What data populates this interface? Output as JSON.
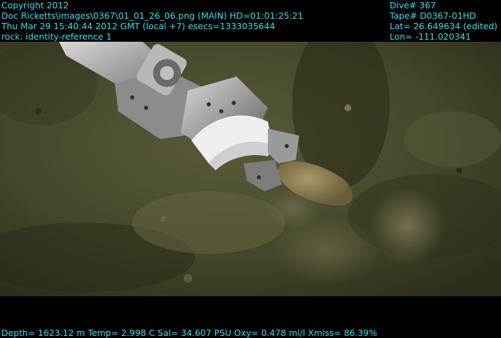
{
  "header_left": {
    "line1": "Copyright 2012",
    "line2": "Doc Ricketts\\images\\0367\\01_01_26_06.png (MAIN)  HD=01:01:25:21",
    "line3": "Thu Mar 29 15:40:44 2012 GMT (local +7)  esecs=1333035644",
    "line4": "rock: identity-reference 1"
  },
  "header_right": {
    "line1": "Dive# 367",
    "line2": "Tape# D0367-01HD",
    "line3": "Lat= 26.649634 (edited)",
    "line4": "Lon= -111.020341"
  },
  "footer": {
    "telemetry": "Depth= 1623.12 m  Temp= 2.998 C  Sal= 34.607 PSU  Oxy= 0.478 ml/l  Xmiss= 86.39%"
  },
  "colors": {
    "overlay_text": "#33e0ee",
    "seafloor": "#4a4a2c",
    "arm_metal": "#a8a8a8"
  }
}
